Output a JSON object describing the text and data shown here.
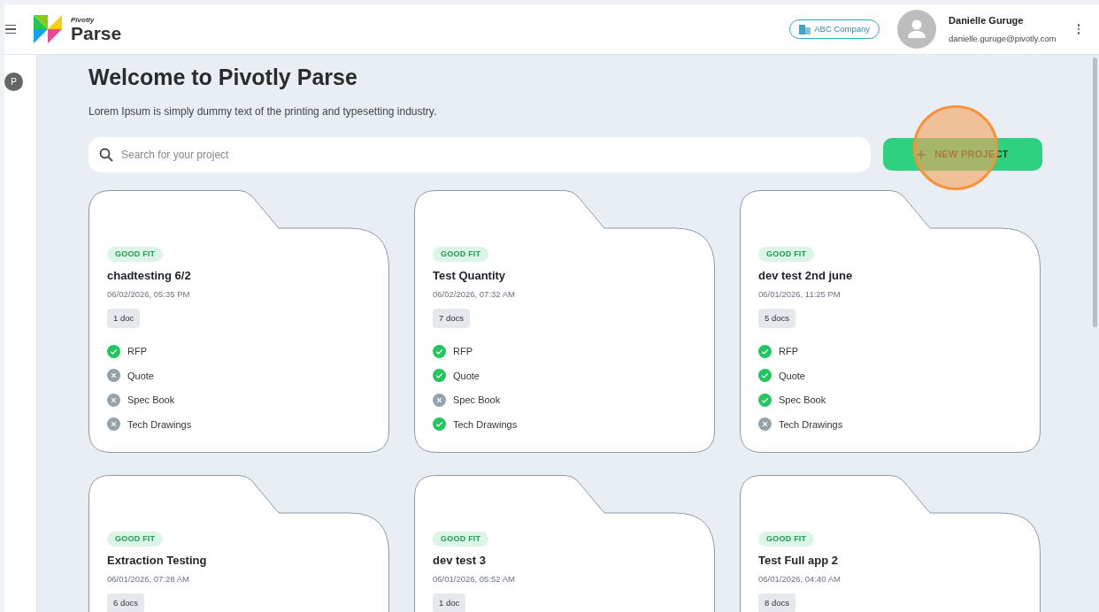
{
  "header": {
    "brand_small": "Pivotly",
    "brand": "Parse",
    "company": "ABC Company",
    "user": {
      "name": "Danielle Guruge",
      "email": "danielle.guruge@pivotly.com"
    }
  },
  "sidebar": {
    "avatar": "P"
  },
  "main": {
    "title": "Welcome to Pivotly Parse",
    "subtitle": "Lorem Ipsum is simply dummy text of the printing and typesetting industry.",
    "search": {
      "placeholder": "Search for your project"
    },
    "new_button": "NEW PROJECT",
    "click_highlight": true
  },
  "projects": [
    {
      "tag": "GOOD FIT",
      "name": "chadtesting 6/2",
      "date": "06/02/2026, 05:35 PM",
      "docs": "1 doc",
      "checks": [
        {
          "label": "RFP",
          "checked": true
        },
        {
          "label": "Quote",
          "checked": false
        },
        {
          "label": "Spec Book",
          "checked": false
        },
        {
          "label": "Tech Drawings",
          "checked": false
        }
      ]
    },
    {
      "tag": "GOOD FIT",
      "name": "Test Quantity",
      "date": "06/02/2026, 07:32 AM",
      "docs": "7 docs",
      "checks": [
        {
          "label": "RFP",
          "checked": true
        },
        {
          "label": "Quote",
          "checked": true
        },
        {
          "label": "Spec Book",
          "checked": false
        },
        {
          "label": "Tech Drawings",
          "checked": true
        }
      ]
    },
    {
      "tag": "GOOD FIT",
      "name": "dev test 2nd june",
      "date": "06/01/2026, 11:25 PM",
      "docs": "5 docs",
      "checks": [
        {
          "label": "RFP",
          "checked": true
        },
        {
          "label": "Quote",
          "checked": true
        },
        {
          "label": "Spec Book",
          "checked": true
        },
        {
          "label": "Tech Drawings",
          "checked": false
        }
      ]
    },
    {
      "tag": "GOOD FIT",
      "name": "Extraction Testing",
      "date": "06/01/2026, 07:28 AM",
      "docs": "6 docs"
    },
    {
      "tag": "GOOD FIT",
      "name": "dev test 3",
      "date": "06/01/2026, 05:52 AM",
      "docs": "1 doc"
    },
    {
      "tag": "GOOD FIT",
      "name": "Test Full app 2",
      "date": "06/01/2026, 04:40 AM",
      "docs": "8 docs"
    }
  ]
}
